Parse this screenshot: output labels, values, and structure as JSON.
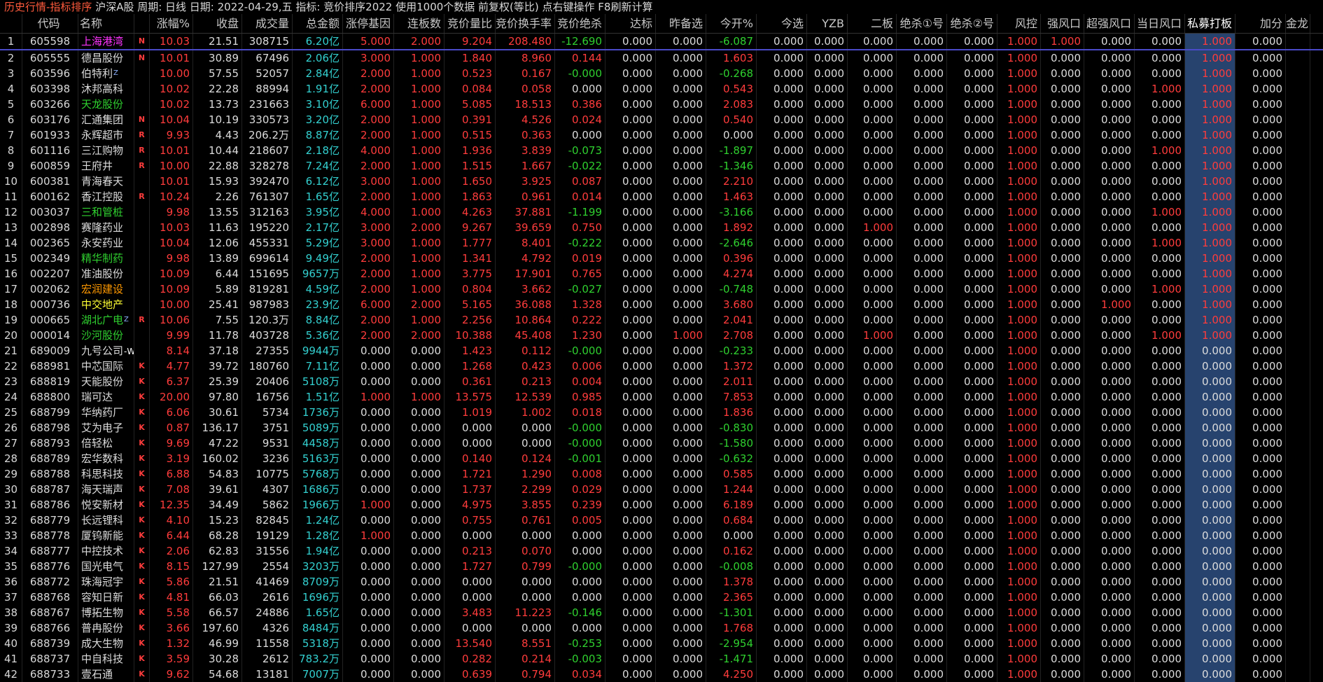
{
  "topbar": {
    "title": "历史行情-指标排序",
    "info": " 沪深A股 周期: 日线 日期: 2022-04-29,五 指标: 竞价排序2022  使用1000个数据 前复权(等比) 点右键操作 F8刷新计算"
  },
  "headers": [
    "",
    "代码",
    "名称",
    "",
    "涨幅%",
    "收盘",
    "成交量",
    "总金额",
    "涨停基因",
    "连板数",
    "竞价量比",
    "竞价换手率",
    "竞价绝杀",
    "达标",
    "昨备选",
    "今开%",
    "今选",
    "YZB",
    "二板",
    "绝杀①号",
    "绝杀②号",
    "风控",
    "强风口",
    "超强风口",
    "当日风口",
    "私募打板",
    "加分",
    "金龙"
  ],
  "colors": {
    "up": "#ff3c3c",
    "down": "#2fd02f",
    "flat": "#dcdcdc",
    "amount": "#33d0d0",
    "highlight": "#27436e"
  },
  "rows": [
    [
      "1",
      "605598",
      "上海港湾",
      "N",
      "10.03",
      "21.51",
      "308715",
      "6.20亿",
      "5.000",
      "2.000",
      "9.204",
      "208.480",
      "-12.690",
      "0.000",
      "0.000",
      "-6.087",
      "0.000",
      "0.000",
      "0.000",
      "0.000",
      "0.000",
      "1.000",
      "1.000",
      "0.000",
      "0.000",
      "1.000",
      "0.000"
    ],
    [
      "2",
      "605555",
      "德昌股份",
      "N",
      "10.01",
      "30.89",
      "67496",
      "2.06亿",
      "3.000",
      "1.000",
      "1.840",
      "8.960",
      "0.144",
      "0.000",
      "0.000",
      "1.603",
      "0.000",
      "0.000",
      "0.000",
      "0.000",
      "0.000",
      "1.000",
      "0.000",
      "0.000",
      "0.000",
      "1.000",
      "0.000"
    ],
    [
      "3",
      "603596",
      "伯特利",
      "",
      "10.00",
      "57.55",
      "52057",
      "2.84亿",
      "2.000",
      "1.000",
      "0.523",
      "0.167",
      "-0.000",
      "0.000",
      "0.000",
      "-0.268",
      "0.000",
      "0.000",
      "0.000",
      "0.000",
      "0.000",
      "1.000",
      "0.000",
      "0.000",
      "0.000",
      "1.000",
      "0.000"
    ],
    [
      "4",
      "603398",
      "沐邦高科",
      "",
      "10.02",
      "22.28",
      "88994",
      "1.91亿",
      "2.000",
      "1.000",
      "0.084",
      "0.058",
      "0.000",
      "0.000",
      "0.000",
      "0.543",
      "0.000",
      "0.000",
      "0.000",
      "0.000",
      "0.000",
      "1.000",
      "0.000",
      "0.000",
      "1.000",
      "1.000",
      "0.000"
    ],
    [
      "5",
      "603266",
      "天龙股份",
      "",
      "10.02",
      "13.73",
      "231663",
      "3.10亿",
      "6.000",
      "1.000",
      "5.085",
      "18.513",
      "0.386",
      "0.000",
      "0.000",
      "2.083",
      "0.000",
      "0.000",
      "0.000",
      "0.000",
      "0.000",
      "1.000",
      "0.000",
      "0.000",
      "0.000",
      "1.000",
      "0.000"
    ],
    [
      "6",
      "603176",
      "汇通集团",
      "N",
      "10.04",
      "10.19",
      "330573",
      "3.20亿",
      "2.000",
      "1.000",
      "0.391",
      "4.526",
      "0.024",
      "0.000",
      "0.000",
      "0.540",
      "0.000",
      "0.000",
      "0.000",
      "0.000",
      "0.000",
      "1.000",
      "0.000",
      "0.000",
      "0.000",
      "1.000",
      "0.000"
    ],
    [
      "7",
      "601933",
      "永辉超市",
      "R",
      "9.93",
      "4.43",
      "206.2万",
      "8.87亿",
      "2.000",
      "1.000",
      "0.515",
      "0.363",
      "0.000",
      "0.000",
      "0.000",
      "0.000",
      "0.000",
      "0.000",
      "0.000",
      "0.000",
      "0.000",
      "1.000",
      "0.000",
      "0.000",
      "0.000",
      "1.000",
      "0.000"
    ],
    [
      "8",
      "601116",
      "三江购物",
      "R",
      "10.01",
      "10.44",
      "218607",
      "2.18亿",
      "4.000",
      "1.000",
      "1.936",
      "3.839",
      "-0.073",
      "0.000",
      "0.000",
      "-1.897",
      "0.000",
      "0.000",
      "0.000",
      "0.000",
      "0.000",
      "1.000",
      "0.000",
      "0.000",
      "1.000",
      "1.000",
      "0.000"
    ],
    [
      "9",
      "600859",
      "王府井",
      "R",
      "10.00",
      "22.88",
      "328278",
      "7.24亿",
      "2.000",
      "1.000",
      "1.515",
      "1.667",
      "-0.022",
      "0.000",
      "0.000",
      "-1.346",
      "0.000",
      "0.000",
      "0.000",
      "0.000",
      "0.000",
      "1.000",
      "0.000",
      "0.000",
      "0.000",
      "1.000",
      "0.000"
    ],
    [
      "10",
      "600381",
      "青海春天",
      "",
      "10.01",
      "15.93",
      "392470",
      "6.12亿",
      "3.000",
      "1.000",
      "1.650",
      "3.925",
      "0.087",
      "0.000",
      "0.000",
      "2.210",
      "0.000",
      "0.000",
      "0.000",
      "0.000",
      "0.000",
      "1.000",
      "0.000",
      "0.000",
      "0.000",
      "1.000",
      "0.000"
    ],
    [
      "11",
      "600162",
      "香江控股",
      "R",
      "10.24",
      "2.26",
      "761307",
      "1.65亿",
      "2.000",
      "1.000",
      "1.863",
      "0.961",
      "0.014",
      "0.000",
      "0.000",
      "1.463",
      "0.000",
      "0.000",
      "0.000",
      "0.000",
      "0.000",
      "1.000",
      "0.000",
      "0.000",
      "0.000",
      "1.000",
      "0.000"
    ],
    [
      "12",
      "003037",
      "三和管桩",
      "",
      "9.98",
      "13.55",
      "312163",
      "3.95亿",
      "4.000",
      "1.000",
      "4.263",
      "37.881",
      "-1.199",
      "0.000",
      "0.000",
      "-3.166",
      "0.000",
      "0.000",
      "0.000",
      "0.000",
      "0.000",
      "1.000",
      "0.000",
      "0.000",
      "1.000",
      "1.000",
      "0.000"
    ],
    [
      "13",
      "002898",
      "赛隆药业",
      "",
      "10.03",
      "11.63",
      "195220",
      "2.17亿",
      "3.000",
      "2.000",
      "9.267",
      "39.659",
      "0.750",
      "0.000",
      "0.000",
      "1.892",
      "0.000",
      "0.000",
      "1.000",
      "0.000",
      "0.000",
      "1.000",
      "0.000",
      "0.000",
      "0.000",
      "1.000",
      "0.000"
    ],
    [
      "14",
      "002365",
      "永安药业",
      "",
      "10.04",
      "12.06",
      "455331",
      "5.29亿",
      "3.000",
      "1.000",
      "1.777",
      "8.401",
      "-0.222",
      "0.000",
      "0.000",
      "-2.646",
      "0.000",
      "0.000",
      "0.000",
      "0.000",
      "0.000",
      "1.000",
      "0.000",
      "0.000",
      "1.000",
      "1.000",
      "0.000"
    ],
    [
      "15",
      "002349",
      "精华制药",
      "",
      "9.98",
      "13.89",
      "699614",
      "9.49亿",
      "2.000",
      "1.000",
      "1.341",
      "4.792",
      "0.019",
      "0.000",
      "0.000",
      "0.396",
      "0.000",
      "0.000",
      "0.000",
      "0.000",
      "0.000",
      "1.000",
      "0.000",
      "0.000",
      "0.000",
      "1.000",
      "0.000"
    ],
    [
      "16",
      "002207",
      "准油股份",
      "",
      "10.09",
      "6.44",
      "151695",
      "9657万",
      "2.000",
      "1.000",
      "3.775",
      "17.901",
      "0.765",
      "0.000",
      "0.000",
      "4.274",
      "0.000",
      "0.000",
      "0.000",
      "0.000",
      "0.000",
      "1.000",
      "0.000",
      "0.000",
      "0.000",
      "1.000",
      "0.000"
    ],
    [
      "17",
      "002062",
      "宏润建设",
      "",
      "10.09",
      "5.89",
      "819281",
      "4.59亿",
      "2.000",
      "1.000",
      "0.804",
      "3.662",
      "-0.027",
      "0.000",
      "0.000",
      "-0.748",
      "0.000",
      "0.000",
      "0.000",
      "0.000",
      "0.000",
      "1.000",
      "0.000",
      "0.000",
      "1.000",
      "1.000",
      "0.000"
    ],
    [
      "18",
      "000736",
      "中交地产",
      "",
      "10.00",
      "25.41",
      "987983",
      "23.9亿",
      "6.000",
      "2.000",
      "5.165",
      "36.088",
      "1.328",
      "0.000",
      "0.000",
      "3.680",
      "0.000",
      "0.000",
      "0.000",
      "0.000",
      "0.000",
      "1.000",
      "0.000",
      "1.000",
      "0.000",
      "1.000",
      "0.000"
    ],
    [
      "19",
      "000665",
      "湖北广电",
      "R",
      "10.06",
      "7.55",
      "120.3万",
      "8.84亿",
      "2.000",
      "1.000",
      "2.256",
      "10.864",
      "0.222",
      "0.000",
      "0.000",
      "2.041",
      "0.000",
      "0.000",
      "0.000",
      "0.000",
      "0.000",
      "1.000",
      "0.000",
      "0.000",
      "0.000",
      "1.000",
      "0.000"
    ],
    [
      "20",
      "000014",
      "沙河股份",
      "",
      "9.99",
      "11.78",
      "403728",
      "5.36亿",
      "2.000",
      "2.000",
      "10.388",
      "45.408",
      "1.230",
      "0.000",
      "1.000",
      "2.708",
      "0.000",
      "0.000",
      "1.000",
      "0.000",
      "0.000",
      "1.000",
      "0.000",
      "0.000",
      "1.000",
      "1.000",
      "0.000"
    ],
    [
      "21",
      "689009",
      "九号公司",
      "",
      "8.14",
      "37.18",
      "27355",
      "9944万",
      "0.000",
      "0.000",
      "1.423",
      "0.112",
      "-0.000",
      "0.000",
      "0.000",
      "-0.233",
      "0.000",
      "0.000",
      "0.000",
      "0.000",
      "0.000",
      "1.000",
      "0.000",
      "0.000",
      "0.000",
      "0.000",
      "0.000"
    ],
    [
      "22",
      "688981",
      "中芯国际",
      "K",
      "4.77",
      "39.72",
      "180760",
      "7.11亿",
      "0.000",
      "0.000",
      "1.268",
      "0.423",
      "0.006",
      "0.000",
      "0.000",
      "1.372",
      "0.000",
      "0.000",
      "0.000",
      "0.000",
      "0.000",
      "1.000",
      "0.000",
      "0.000",
      "0.000",
      "0.000",
      "0.000"
    ],
    [
      "23",
      "688819",
      "天能股份",
      "K",
      "6.37",
      "25.39",
      "20406",
      "5108万",
      "0.000",
      "0.000",
      "0.361",
      "0.213",
      "0.004",
      "0.000",
      "0.000",
      "2.011",
      "0.000",
      "0.000",
      "0.000",
      "0.000",
      "0.000",
      "1.000",
      "0.000",
      "0.000",
      "0.000",
      "0.000",
      "0.000"
    ],
    [
      "24",
      "688800",
      "瑞可达",
      "K",
      "20.00",
      "97.80",
      "16756",
      "1.51亿",
      "1.000",
      "1.000",
      "13.575",
      "12.539",
      "0.985",
      "0.000",
      "0.000",
      "7.853",
      "0.000",
      "0.000",
      "0.000",
      "0.000",
      "0.000",
      "1.000",
      "0.000",
      "0.000",
      "0.000",
      "0.000",
      "0.000"
    ],
    [
      "25",
      "688799",
      "华纳药厂",
      "K",
      "6.06",
      "30.61",
      "5734",
      "1736万",
      "0.000",
      "0.000",
      "1.019",
      "1.002",
      "0.018",
      "0.000",
      "0.000",
      "1.836",
      "0.000",
      "0.000",
      "0.000",
      "0.000",
      "0.000",
      "1.000",
      "0.000",
      "0.000",
      "0.000",
      "0.000",
      "0.000"
    ],
    [
      "26",
      "688798",
      "艾为电子",
      "K",
      "0.87",
      "136.17",
      "3751",
      "5089万",
      "0.000",
      "0.000",
      "0.000",
      "0.000",
      "-0.000",
      "0.000",
      "0.000",
      "-0.830",
      "0.000",
      "0.000",
      "0.000",
      "0.000",
      "0.000",
      "1.000",
      "0.000",
      "0.000",
      "0.000",
      "0.000",
      "0.000"
    ],
    [
      "27",
      "688793",
      "倍轻松",
      "K",
      "9.69",
      "47.22",
      "9531",
      "4458万",
      "0.000",
      "0.000",
      "0.000",
      "0.000",
      "-0.000",
      "0.000",
      "0.000",
      "-1.580",
      "0.000",
      "0.000",
      "0.000",
      "0.000",
      "0.000",
      "1.000",
      "0.000",
      "0.000",
      "0.000",
      "0.000",
      "0.000"
    ],
    [
      "28",
      "688789",
      "宏华数科",
      "K",
      "3.19",
      "160.02",
      "3236",
      "5163万",
      "0.000",
      "0.000",
      "0.140",
      "0.124",
      "-0.001",
      "0.000",
      "0.000",
      "-0.632",
      "0.000",
      "0.000",
      "0.000",
      "0.000",
      "0.000",
      "1.000",
      "0.000",
      "0.000",
      "0.000",
      "0.000",
      "0.000"
    ],
    [
      "29",
      "688788",
      "科思科技",
      "K",
      "6.88",
      "54.83",
      "10775",
      "5768万",
      "0.000",
      "0.000",
      "1.721",
      "1.290",
      "0.008",
      "0.000",
      "0.000",
      "0.585",
      "0.000",
      "0.000",
      "0.000",
      "0.000",
      "0.000",
      "1.000",
      "0.000",
      "0.000",
      "0.000",
      "0.000",
      "0.000"
    ],
    [
      "30",
      "688787",
      "海天瑞声",
      "K",
      "7.08",
      "39.61",
      "4307",
      "1686万",
      "0.000",
      "0.000",
      "1.737",
      "2.299",
      "0.029",
      "0.000",
      "0.000",
      "1.244",
      "0.000",
      "0.000",
      "0.000",
      "0.000",
      "0.000",
      "1.000",
      "0.000",
      "0.000",
      "0.000",
      "0.000",
      "0.000"
    ],
    [
      "31",
      "688786",
      "悦安新材",
      "K",
      "12.35",
      "34.49",
      "5862",
      "1966万",
      "1.000",
      "0.000",
      "4.975",
      "3.855",
      "0.239",
      "0.000",
      "0.000",
      "6.189",
      "0.000",
      "0.000",
      "0.000",
      "0.000",
      "0.000",
      "1.000",
      "0.000",
      "0.000",
      "0.000",
      "0.000",
      "0.000"
    ],
    [
      "32",
      "688779",
      "长远锂科",
      "K",
      "4.10",
      "15.23",
      "82845",
      "1.24亿",
      "0.000",
      "0.000",
      "0.755",
      "0.761",
      "0.005",
      "0.000",
      "0.000",
      "0.684",
      "0.000",
      "0.000",
      "0.000",
      "0.000",
      "0.000",
      "1.000",
      "0.000",
      "0.000",
      "0.000",
      "0.000",
      "0.000"
    ],
    [
      "33",
      "688778",
      "厦钨新能",
      "K",
      "6.44",
      "68.28",
      "19129",
      "1.28亿",
      "1.000",
      "0.000",
      "0.000",
      "0.000",
      "0.000",
      "0.000",
      "0.000",
      "0.000",
      "0.000",
      "0.000",
      "0.000",
      "0.000",
      "0.000",
      "1.000",
      "0.000",
      "0.000",
      "0.000",
      "0.000",
      "0.000"
    ],
    [
      "34",
      "688777",
      "中控技术",
      "K",
      "2.06",
      "62.83",
      "31556",
      "1.94亿",
      "0.000",
      "0.000",
      "0.213",
      "0.070",
      "0.000",
      "0.000",
      "0.000",
      "0.162",
      "0.000",
      "0.000",
      "0.000",
      "0.000",
      "0.000",
      "1.000",
      "0.000",
      "0.000",
      "0.000",
      "0.000",
      "0.000"
    ],
    [
      "35",
      "688776",
      "国光电气",
      "K",
      "8.15",
      "127.99",
      "2554",
      "3203万",
      "0.000",
      "0.000",
      "1.727",
      "0.799",
      "-0.000",
      "0.000",
      "0.000",
      "-0.008",
      "0.000",
      "0.000",
      "0.000",
      "0.000",
      "0.000",
      "1.000",
      "0.000",
      "0.000",
      "0.000",
      "0.000",
      "0.000"
    ],
    [
      "36",
      "688772",
      "珠海冠宇",
      "K",
      "5.86",
      "21.51",
      "41469",
      "8709万",
      "0.000",
      "0.000",
      "0.000",
      "0.000",
      "0.000",
      "0.000",
      "0.000",
      "1.378",
      "0.000",
      "0.000",
      "0.000",
      "0.000",
      "0.000",
      "1.000",
      "0.000",
      "0.000",
      "0.000",
      "0.000",
      "0.000"
    ],
    [
      "37",
      "688768",
      "容知日新",
      "K",
      "4.81",
      "66.03",
      "2616",
      "1696万",
      "0.000",
      "0.000",
      "0.000",
      "0.000",
      "0.000",
      "0.000",
      "0.000",
      "2.365",
      "0.000",
      "0.000",
      "0.000",
      "0.000",
      "0.000",
      "1.000",
      "0.000",
      "0.000",
      "0.000",
      "0.000",
      "0.000"
    ],
    [
      "38",
      "688767",
      "博拓生物",
      "K",
      "5.58",
      "66.57",
      "24886",
      "1.65亿",
      "0.000",
      "0.000",
      "3.483",
      "11.223",
      "-0.146",
      "0.000",
      "0.000",
      "-1.301",
      "0.000",
      "0.000",
      "0.000",
      "0.000",
      "0.000",
      "1.000",
      "0.000",
      "0.000",
      "0.000",
      "0.000",
      "0.000"
    ],
    [
      "39",
      "688766",
      "普冉股份",
      "K",
      "3.66",
      "197.60",
      "4326",
      "8484万",
      "0.000",
      "0.000",
      "0.000",
      "0.000",
      "0.000",
      "0.000",
      "0.000",
      "1.768",
      "0.000",
      "0.000",
      "0.000",
      "0.000",
      "0.000",
      "1.000",
      "0.000",
      "0.000",
      "0.000",
      "0.000",
      "0.000"
    ],
    [
      "40",
      "688739",
      "成大生物",
      "K",
      "1.32",
      "46.99",
      "11558",
      "5318万",
      "0.000",
      "0.000",
      "13.540",
      "8.551",
      "-0.253",
      "0.000",
      "0.000",
      "-2.954",
      "0.000",
      "0.000",
      "0.000",
      "0.000",
      "0.000",
      "1.000",
      "0.000",
      "0.000",
      "0.000",
      "0.000",
      "0.000"
    ],
    [
      "41",
      "688737",
      "中自科技",
      "K",
      "3.59",
      "30.28",
      "2612",
      "783.2万",
      "0.000",
      "0.000",
      "0.282",
      "0.214",
      "-0.003",
      "0.000",
      "0.000",
      "-1.471",
      "0.000",
      "0.000",
      "0.000",
      "0.000",
      "0.000",
      "1.000",
      "0.000",
      "0.000",
      "0.000",
      "0.000",
      "0.000"
    ],
    [
      "42",
      "688733",
      "壹石通",
      "K",
      "9.62",
      "54.68",
      "13181",
      "7007万",
      "0.000",
      "0.000",
      "0.639",
      "0.794",
      "0.034",
      "0.000",
      "0.000",
      "4.250",
      "0.000",
      "0.000",
      "0.000",
      "0.000",
      "0.000",
      "1.000",
      "0.000",
      "0.000",
      "0.000",
      "0.000",
      "0.000"
    ]
  ],
  "name_colors": {
    "上海港湾": "magenta",
    "天龙股份": "green",
    "三和管桩": "green",
    "精华制药": "green",
    "宏润建设": "orange",
    "中交地产": "yellow",
    "湖北广电": "green",
    "沙河股份": "green"
  },
  "superscripts": {
    "3": "Z",
    "19": "Z"
  },
  "suffixes": {
    "21": "-WD"
  }
}
